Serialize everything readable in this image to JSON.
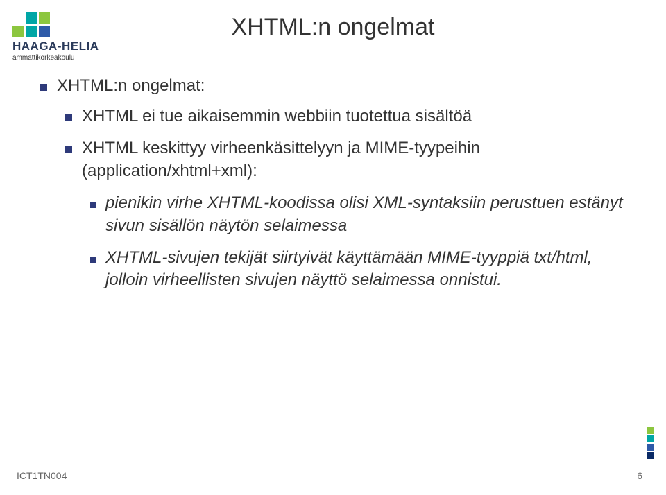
{
  "logo": {
    "name": "HAAGA-HELIA",
    "subtitle": "ammattikorkeakoulu"
  },
  "title": "XHTML:n ongelmat",
  "bullets": {
    "lvl1": "XHTML:n ongelmat:",
    "lvl2a": "XHTML ei tue aikaisemmin webbiin tuotettua sisältöä",
    "lvl2b": "XHTML keskittyy virheenkäsittelyyn ja MIME-tyypeihin (application/xhtml+xml):",
    "lvl3a": "pienikin virhe XHTML-koodissa olisi XML-syntaksiin perustuen estänyt sivun sisällön näytön selaimessa",
    "lvl3b": "XHTML-sivujen tekijät siirtyivät käyttämään MIME-tyyppiä txt/html, jolloin virheellisten sivujen näyttö selaimessa onnistui."
  },
  "footer": {
    "course": "ICT1TN004",
    "page": "6"
  }
}
